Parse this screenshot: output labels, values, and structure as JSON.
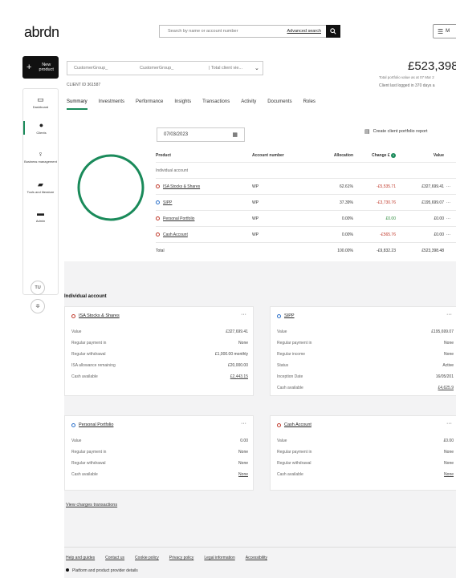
{
  "brand": {
    "logo_text": "abrdn"
  },
  "search": {
    "placeholder": "Search by name or account number",
    "advanced_label": "Advanced search"
  },
  "menu": {
    "label": "M"
  },
  "sidebar": {
    "new_product_label": "New product",
    "items": [
      {
        "label": "Dashboard",
        "icon": "monitor-icon"
      },
      {
        "label": "Clients",
        "icon": "people-icon"
      },
      {
        "label": "Business management",
        "icon": "lightbulb-icon"
      },
      {
        "label": "Tools and literature",
        "icon": "book-icon"
      },
      {
        "label": "Admin",
        "icon": "flag-icon"
      }
    ],
    "user_initials": "TU"
  },
  "client": {
    "group_1": "CustomerGroup_",
    "group_2": "CustomerGroup_",
    "select_value": "| Total client vie...",
    "client_id": "CLIENT ID 361587",
    "portfolio_value": "£523,398.",
    "portfolio_note": "Total portfolio value as at 07 Mar 2",
    "last_login": "Client last logged in 370 days a"
  },
  "tabs": [
    "Summary",
    "Investments",
    "Performance",
    "Insights",
    "Transactions",
    "Activity",
    "Documents",
    "Roles"
  ],
  "summary": {
    "date_value": "07/03/2023",
    "create_report_label": "Create client portfolio report",
    "columns": [
      "Product",
      "Account number",
      "Allocation",
      "Change £",
      "Value"
    ],
    "group_label": "Individual account",
    "rows": [
      {
        "product": "ISA Stocks & Shares",
        "account": "WP",
        "allocation": "62.61%",
        "change": "-£5,535.71",
        "value": "£327,699.41",
        "color": "#c0392b",
        "change_type": "neg"
      },
      {
        "product": "SIPP",
        "account": "WP",
        "allocation": "37.39%",
        "change": "-£3,730.76",
        "value": "£195,699.07",
        "color": "#2a6fc9",
        "change_type": "neg"
      },
      {
        "product": "Personal Portfolio",
        "account": "WP",
        "allocation": "0.00%",
        "change": "£0.00",
        "value": "£0.00",
        "color": "#c0392b",
        "change_type": "pos"
      },
      {
        "product": "Cash Account",
        "account": "WP",
        "allocation": "0.00%",
        "change": "-£565.76",
        "value": "£0.00",
        "color": "#c0392b",
        "change_type": "neg"
      }
    ],
    "total": {
      "label": "Total",
      "allocation": "100.00%",
      "change": "-£9,832.23",
      "value": "£523,398.48"
    },
    "more_glyph": "···",
    "donut_color": "#1a8a5a"
  },
  "individual_account": {
    "title": "Individual account",
    "cards": [
      {
        "name": "ISA Stocks & Shares",
        "color": "#c0392b",
        "rows": [
          {
            "k": "Value",
            "v": "£327,699.41"
          },
          {
            "k": "Regular payment in",
            "v": "None"
          },
          {
            "k": "Regular withdrawal",
            "v": "£1,000.00 monthly"
          },
          {
            "k": "ISA allowance remaining",
            "v": "£20,000.00"
          },
          {
            "k": "Cash available",
            "v": "£2,443.15"
          }
        ]
      },
      {
        "name": "SIPP",
        "color": "#2a6fc9",
        "rows": [
          {
            "k": "Value",
            "v": "£195,699.07"
          },
          {
            "k": "Regular payment in",
            "v": "None"
          },
          {
            "k": "Regular income",
            "v": "None"
          },
          {
            "k": "Status",
            "v": "Active"
          },
          {
            "k": "Inception Date",
            "v": "16/05/201"
          },
          {
            "k": "Cash available",
            "v": "£4,625.9"
          }
        ]
      },
      {
        "name": "Personal Portfolio",
        "color": "#2a6fc9",
        "rows": [
          {
            "k": "Value",
            "v": "0.00"
          },
          {
            "k": "Regular payment in",
            "v": "None"
          },
          {
            "k": "Regular withdrawal",
            "v": "None"
          },
          {
            "k": "Cash available",
            "v": "None"
          }
        ]
      },
      {
        "name": "Cash Account",
        "color": "#c0392b",
        "rows": [
          {
            "k": "Value",
            "v": "£0.00"
          },
          {
            "k": "Regular payment in",
            "v": "None"
          },
          {
            "k": "Regular withdrawal",
            "v": "None"
          },
          {
            "k": "Cash available",
            "v": "None"
          }
        ]
      }
    ],
    "view_charges_label": "View charges transactions"
  },
  "footer": {
    "links": [
      "Help and guides",
      "Contact us",
      "Cookie policy",
      "Privacy policy",
      "Legal information",
      "Accessibility"
    ],
    "note": "Platform and product provider details"
  }
}
